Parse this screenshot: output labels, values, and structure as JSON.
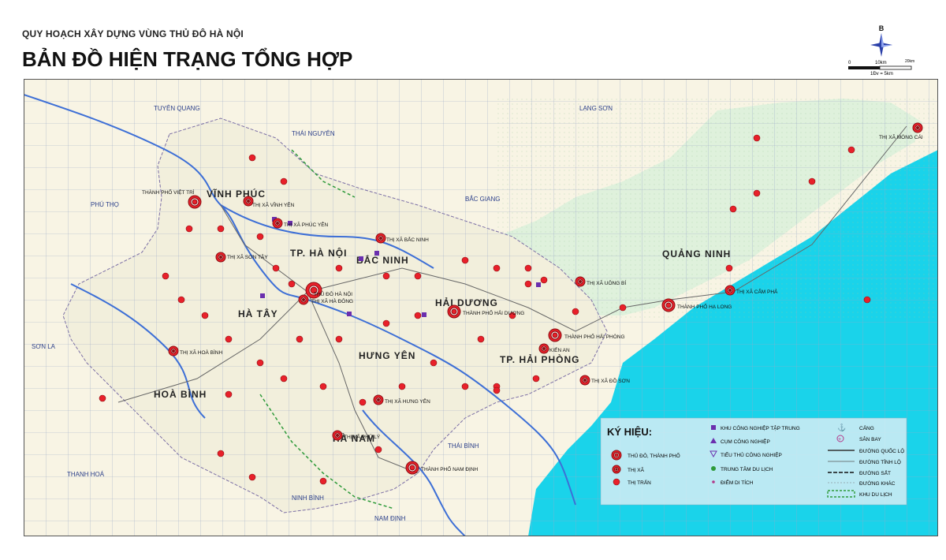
{
  "header": {
    "subtitle": "QUY HOẠCH XÂY DỰNG VÙNG THỦ ĐÔ HÀ NỘI",
    "title": "BẢN ĐỒ HIỆN TRẠNG TỔNG HỢP"
  },
  "compass": {
    "north_label": "B"
  },
  "scale": {
    "zero": "0",
    "mid": "10km",
    "end": "20km",
    "note": "1Đv = 5km"
  },
  "colors": {
    "sea": "#1ad3ea",
    "land_core": "#f2efdc",
    "land_quangninh": "#dff1dc",
    "land_outer": "#f8f4e4",
    "grid": "#9aa8c6",
    "city_marker": "#e8202a",
    "industrial": "#6a2fae",
    "tourism_border": "#2e9a3a",
    "river": "#3d6fd6"
  },
  "neighbors": {
    "tuyen_quang": "TUYÊN QUANG",
    "thai_nguyen": "THÁI NGUYÊN",
    "lang_son": "LẠNG SƠN",
    "bac_giang": "BẮC GIANG",
    "phu_tho": "PHÚ THỌ",
    "son_la": "SƠN LA",
    "thanh_hoa": "THANH HOÁ",
    "ninh_binh": "NINH BÌNH",
    "nam_dinh": "NAM ĐỊNH",
    "thai_binh": "THÁI BÌNH"
  },
  "provinces": {
    "vinh_phuc": "VĨNH PHÚC",
    "ha_noi": "TP. HÀ NỘI",
    "bac_ninh": "BẮC NINH",
    "ha_tay": "HÀ TÂY",
    "hai_duong": "HẢI DƯƠNG",
    "hung_yen": "HƯNG YÊN",
    "hai_phong": "TP. HẢI PHÒNG",
    "hoa_binh": "HOÀ BÌNH",
    "ha_nam": "HÀ NAM",
    "quang_ninh": "QUẢNG NINH"
  },
  "places": {
    "viet_tri": "THÀNH PHỐ VIỆT TRÌ",
    "vinh_yen": "THỊ XÃ VĨNH YÊN",
    "phuc_yen": "THỊ XÃ PHÚC YÊN",
    "bac_ninh": "THỊ XÃ BẮC NINH",
    "son_tay": "THỊ XÃ SƠN TÂY",
    "thu_do": "THỦ ĐÔ HÀ NỘI",
    "ha_dong": "THỊ XÃ HÀ ĐÔNG",
    "hai_duong": "THÀNH PHỐ HẢI DƯƠNG",
    "uong_bi": "THỊ XÃ UÔNG BÍ",
    "cam_pha": "THỊ XÃ CẨM PHẢ",
    "ha_long": "THÀNH PHỐ HẠ LONG",
    "mong_cai": "THỊ XÃ MÓNG CÁI",
    "hai_phong": "THÀNH PHỐ HẢI PHÒNG",
    "kien_an": "KIẾN AN",
    "do_son": "THỊ XÃ ĐỒ SƠN",
    "hoa_binh": "THỊ XÃ HOÀ BÌNH",
    "hung_yen": "THỊ XÃ HƯNG YÊN",
    "phu_ly": "THỊ XÃ PHỦ LÝ",
    "nam_dinh": "THÀNH PHỐ NAM ĐỊNH"
  },
  "legend": {
    "title": "KÝ HIỆU:",
    "capital": "THỦ ĐÔ, THÀNH PHỐ",
    "town": "THỊ XÃ",
    "township": "THỊ TRẤN",
    "industrial_zone": "KHU CÔNG NGHIỆP TẬP TRUNG",
    "industrial_cluster": "CỤM CÔNG NGHIỆP",
    "small_industry": "TIỂU THỦ CÔNG NGHIỆP",
    "tourism_center": "TRUNG TÂM DU LỊCH",
    "relic": "ĐIỂM DI TÍCH",
    "port": "CẢNG",
    "airport": "SÂN BAY",
    "national_road": "ĐƯỜNG QUỐC LỘ",
    "provincial_road": "ĐƯỜNG TỈNH LỘ",
    "railway": "ĐƯỜNG SẮT",
    "other_road": "ĐƯỜNG KHÁC",
    "tourism_zone": "KHU DU LỊCH"
  }
}
